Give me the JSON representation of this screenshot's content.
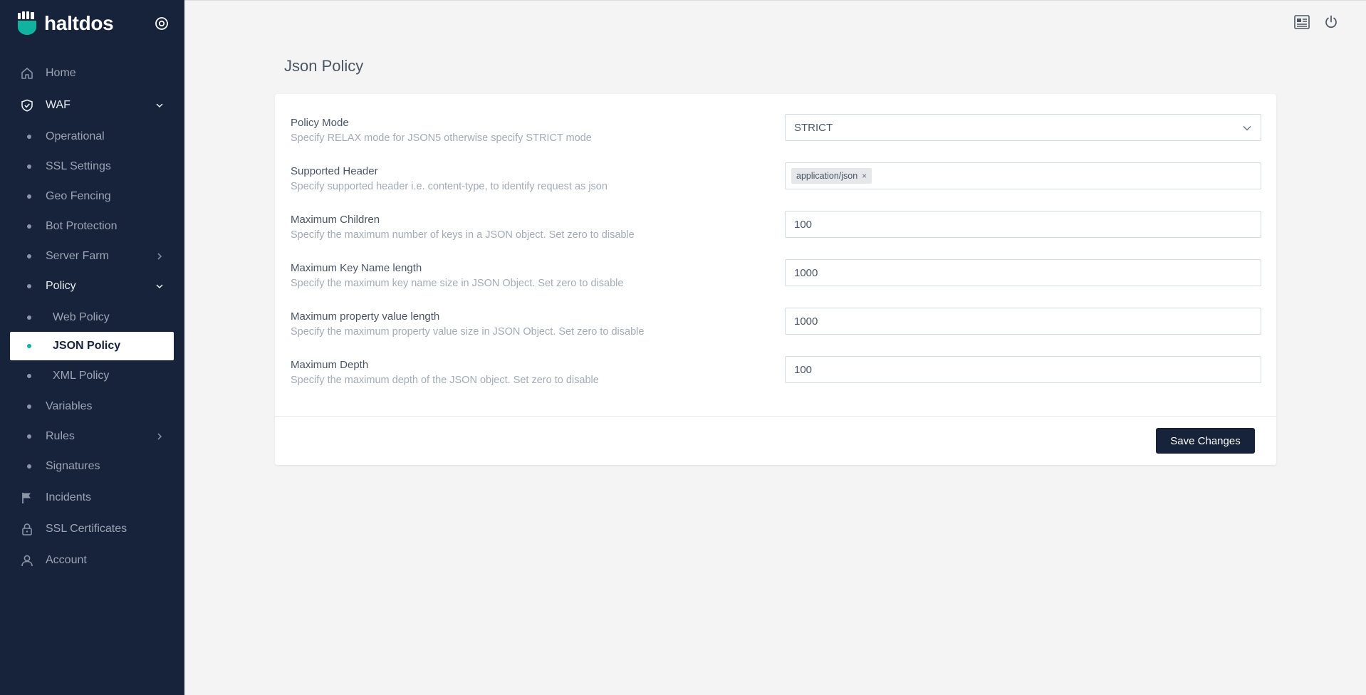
{
  "brand": {
    "name": "haltdos"
  },
  "sidebar": {
    "items": [
      {
        "label": "Home",
        "icon": "home-icon"
      },
      {
        "label": "WAF",
        "icon": "shield-check-icon"
      },
      {
        "label": "Operational"
      },
      {
        "label": "SSL Settings"
      },
      {
        "label": "Geo Fencing"
      },
      {
        "label": "Bot Protection"
      },
      {
        "label": "Server Farm"
      },
      {
        "label": "Policy"
      },
      {
        "label": "Web Policy"
      },
      {
        "label": "JSON Policy"
      },
      {
        "label": "XML Policy"
      },
      {
        "label": "Variables"
      },
      {
        "label": "Rules"
      },
      {
        "label": "Signatures"
      },
      {
        "label": "Incidents",
        "icon": "flag-icon"
      },
      {
        "label": "SSL Certificates",
        "icon": "lock-icon"
      },
      {
        "label": "Account",
        "icon": "user-icon"
      }
    ],
    "active": "JSON Policy"
  },
  "header": {
    "icons": [
      "news-icon",
      "power-icon"
    ]
  },
  "page": {
    "title": "Json Policy"
  },
  "form": {
    "policy_mode": {
      "label": "Policy Mode",
      "desc": "Specify RELAX mode for JSON5 otherwise specify STRICT mode",
      "value": "STRICT"
    },
    "supported_header": {
      "label": "Supported Header",
      "desc": "Specify supported header i.e. content-type, to identify request as json",
      "tags": [
        "application/json"
      ]
    },
    "max_children": {
      "label": "Maximum Children",
      "desc": "Specify the maximum number of keys in a JSON object. Set zero to disable",
      "value": "100"
    },
    "max_key_length": {
      "label": "Maximum Key Name length",
      "desc": "Specify the maximum key name size in JSON Object. Set zero to disable",
      "value": "1000"
    },
    "max_value_length": {
      "label": "Maximum property value length",
      "desc": "Specify the maximum property value size in JSON Object. Set zero to disable",
      "value": "1000"
    },
    "max_depth": {
      "label": "Maximum Depth",
      "desc": "Specify the maximum depth of the JSON object. Set zero to disable",
      "value": "100"
    },
    "save_label": "Save Changes",
    "tag_remove": "×"
  },
  "colors": {
    "sidebar_bg": "#16233a",
    "accent": "#10b3a0",
    "page_bg": "#f3f4f3"
  }
}
